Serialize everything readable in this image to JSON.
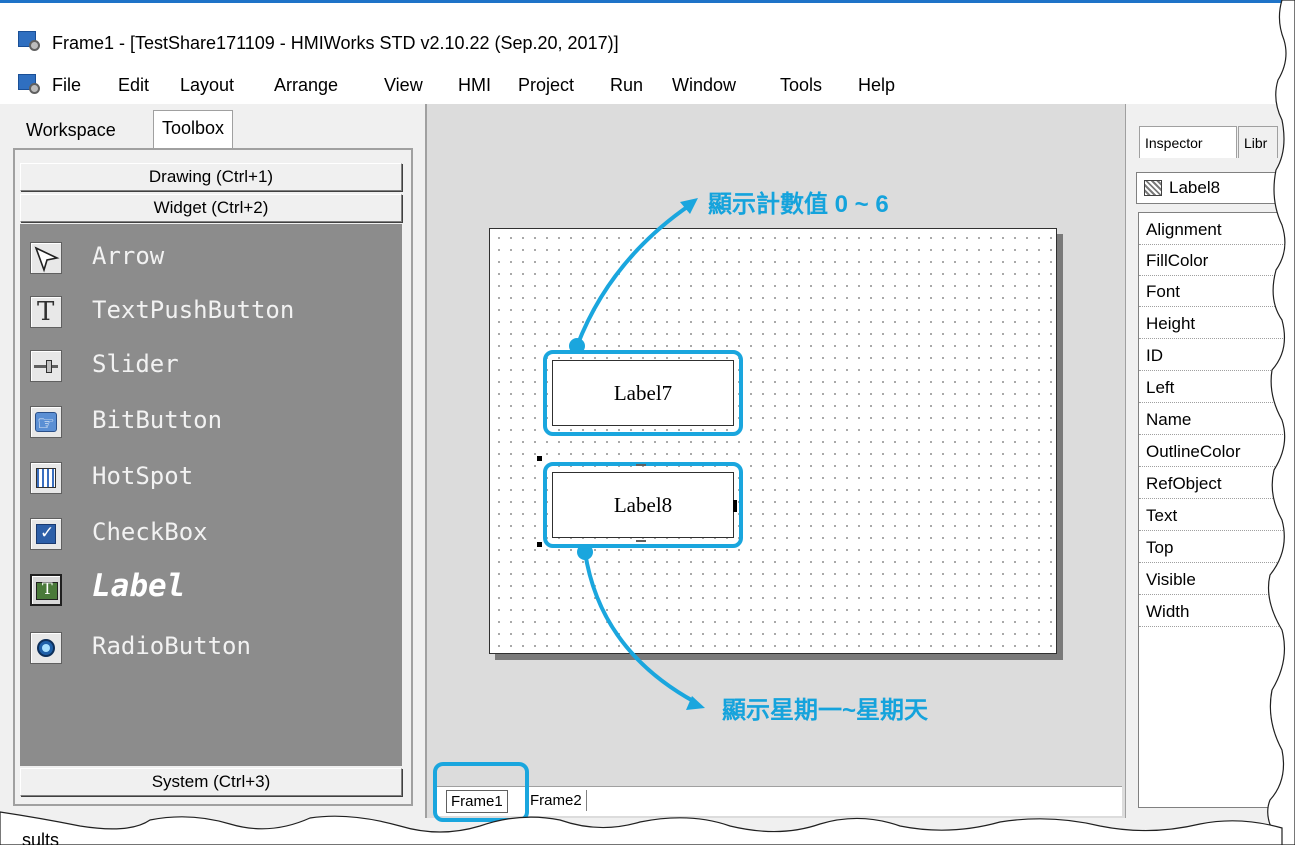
{
  "window": {
    "title": "Frame1 - [TestShare171109 - HMIWorks STD v2.10.22 (Sep.20, 2017)]"
  },
  "menu": [
    "File",
    "Edit",
    "Layout",
    "Arrange",
    "View",
    "HMI",
    "Project",
    "Run",
    "Window",
    "Tools",
    "Help"
  ],
  "left_panel": {
    "tabs": [
      "Workspace",
      "Toolbox"
    ],
    "active_tab": "Toolbox",
    "sections": {
      "drawing": "Drawing (Ctrl+1)",
      "widget": "Widget (Ctrl+2)",
      "system": "System (Ctrl+3)"
    },
    "tools": [
      {
        "label": "Arrow",
        "icon": "arrow-cursor-icon"
      },
      {
        "label": "TextPushButton",
        "icon": "text-t-icon"
      },
      {
        "label": "Slider",
        "icon": "slider-icon"
      },
      {
        "label": "BitButton",
        "icon": "hand-pointer-icon"
      },
      {
        "label": "HotSpot",
        "icon": "hotspot-grid-icon"
      },
      {
        "label": "CheckBox",
        "icon": "checkbox-icon"
      },
      {
        "label": "Label",
        "icon": "label-icon",
        "selected": true
      },
      {
        "label": "RadioButton",
        "icon": "radio-icon"
      }
    ]
  },
  "canvas": {
    "labels": [
      "Label7",
      "Label8"
    ],
    "selected_label": "Label8",
    "page_tabs": [
      "Frame1",
      "Frame2"
    ],
    "active_page": "Frame1"
  },
  "annotations": {
    "top": "顯示計數值 0 ~ 6",
    "bottom": "顯示星期一~星期天",
    "accent_color": "#1aa6de"
  },
  "right_panel": {
    "tabs": [
      "Inspector",
      "Libr"
    ],
    "active_tab": "Inspector",
    "selected_object": "Label8",
    "properties": [
      "Alignment",
      "FillColor",
      "Font",
      "Height",
      "ID",
      "Left",
      "Name",
      "OutlineColor",
      "RefObject",
      "Text",
      "Top",
      "Visible",
      "Width"
    ]
  },
  "bottom": {
    "results_label": "sults"
  }
}
